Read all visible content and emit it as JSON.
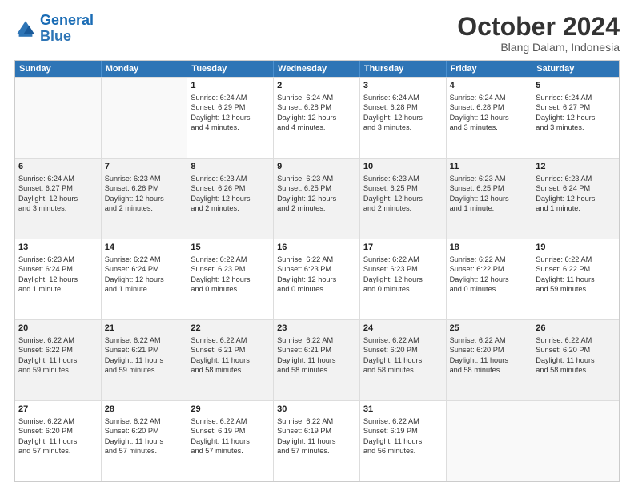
{
  "header": {
    "logo_general": "General",
    "logo_blue": "Blue",
    "title": "October 2024",
    "subtitle": "Blang Dalam, Indonesia"
  },
  "days": [
    "Sunday",
    "Monday",
    "Tuesday",
    "Wednesday",
    "Thursday",
    "Friday",
    "Saturday"
  ],
  "rows": [
    [
      {
        "day": "",
        "info": ""
      },
      {
        "day": "",
        "info": ""
      },
      {
        "day": "1",
        "info": "Sunrise: 6:24 AM\nSunset: 6:29 PM\nDaylight: 12 hours\nand 4 minutes."
      },
      {
        "day": "2",
        "info": "Sunrise: 6:24 AM\nSunset: 6:28 PM\nDaylight: 12 hours\nand 4 minutes."
      },
      {
        "day": "3",
        "info": "Sunrise: 6:24 AM\nSunset: 6:28 PM\nDaylight: 12 hours\nand 3 minutes."
      },
      {
        "day": "4",
        "info": "Sunrise: 6:24 AM\nSunset: 6:28 PM\nDaylight: 12 hours\nand 3 minutes."
      },
      {
        "day": "5",
        "info": "Sunrise: 6:24 AM\nSunset: 6:27 PM\nDaylight: 12 hours\nand 3 minutes."
      }
    ],
    [
      {
        "day": "6",
        "info": "Sunrise: 6:24 AM\nSunset: 6:27 PM\nDaylight: 12 hours\nand 3 minutes."
      },
      {
        "day": "7",
        "info": "Sunrise: 6:23 AM\nSunset: 6:26 PM\nDaylight: 12 hours\nand 2 minutes."
      },
      {
        "day": "8",
        "info": "Sunrise: 6:23 AM\nSunset: 6:26 PM\nDaylight: 12 hours\nand 2 minutes."
      },
      {
        "day": "9",
        "info": "Sunrise: 6:23 AM\nSunset: 6:25 PM\nDaylight: 12 hours\nand 2 minutes."
      },
      {
        "day": "10",
        "info": "Sunrise: 6:23 AM\nSunset: 6:25 PM\nDaylight: 12 hours\nand 2 minutes."
      },
      {
        "day": "11",
        "info": "Sunrise: 6:23 AM\nSunset: 6:25 PM\nDaylight: 12 hours\nand 1 minute."
      },
      {
        "day": "12",
        "info": "Sunrise: 6:23 AM\nSunset: 6:24 PM\nDaylight: 12 hours\nand 1 minute."
      }
    ],
    [
      {
        "day": "13",
        "info": "Sunrise: 6:23 AM\nSunset: 6:24 PM\nDaylight: 12 hours\nand 1 minute."
      },
      {
        "day": "14",
        "info": "Sunrise: 6:22 AM\nSunset: 6:24 PM\nDaylight: 12 hours\nand 1 minute."
      },
      {
        "day": "15",
        "info": "Sunrise: 6:22 AM\nSunset: 6:23 PM\nDaylight: 12 hours\nand 0 minutes."
      },
      {
        "day": "16",
        "info": "Sunrise: 6:22 AM\nSunset: 6:23 PM\nDaylight: 12 hours\nand 0 minutes."
      },
      {
        "day": "17",
        "info": "Sunrise: 6:22 AM\nSunset: 6:23 PM\nDaylight: 12 hours\nand 0 minutes."
      },
      {
        "day": "18",
        "info": "Sunrise: 6:22 AM\nSunset: 6:22 PM\nDaylight: 12 hours\nand 0 minutes."
      },
      {
        "day": "19",
        "info": "Sunrise: 6:22 AM\nSunset: 6:22 PM\nDaylight: 11 hours\nand 59 minutes."
      }
    ],
    [
      {
        "day": "20",
        "info": "Sunrise: 6:22 AM\nSunset: 6:22 PM\nDaylight: 11 hours\nand 59 minutes."
      },
      {
        "day": "21",
        "info": "Sunrise: 6:22 AM\nSunset: 6:21 PM\nDaylight: 11 hours\nand 59 minutes."
      },
      {
        "day": "22",
        "info": "Sunrise: 6:22 AM\nSunset: 6:21 PM\nDaylight: 11 hours\nand 58 minutes."
      },
      {
        "day": "23",
        "info": "Sunrise: 6:22 AM\nSunset: 6:21 PM\nDaylight: 11 hours\nand 58 minutes."
      },
      {
        "day": "24",
        "info": "Sunrise: 6:22 AM\nSunset: 6:20 PM\nDaylight: 11 hours\nand 58 minutes."
      },
      {
        "day": "25",
        "info": "Sunrise: 6:22 AM\nSunset: 6:20 PM\nDaylight: 11 hours\nand 58 minutes."
      },
      {
        "day": "26",
        "info": "Sunrise: 6:22 AM\nSunset: 6:20 PM\nDaylight: 11 hours\nand 58 minutes."
      }
    ],
    [
      {
        "day": "27",
        "info": "Sunrise: 6:22 AM\nSunset: 6:20 PM\nDaylight: 11 hours\nand 57 minutes."
      },
      {
        "day": "28",
        "info": "Sunrise: 6:22 AM\nSunset: 6:20 PM\nDaylight: 11 hours\nand 57 minutes."
      },
      {
        "day": "29",
        "info": "Sunrise: 6:22 AM\nSunset: 6:19 PM\nDaylight: 11 hours\nand 57 minutes."
      },
      {
        "day": "30",
        "info": "Sunrise: 6:22 AM\nSunset: 6:19 PM\nDaylight: 11 hours\nand 57 minutes."
      },
      {
        "day": "31",
        "info": "Sunrise: 6:22 AM\nSunset: 6:19 PM\nDaylight: 11 hours\nand 56 minutes."
      },
      {
        "day": "",
        "info": ""
      },
      {
        "day": "",
        "info": ""
      }
    ]
  ]
}
